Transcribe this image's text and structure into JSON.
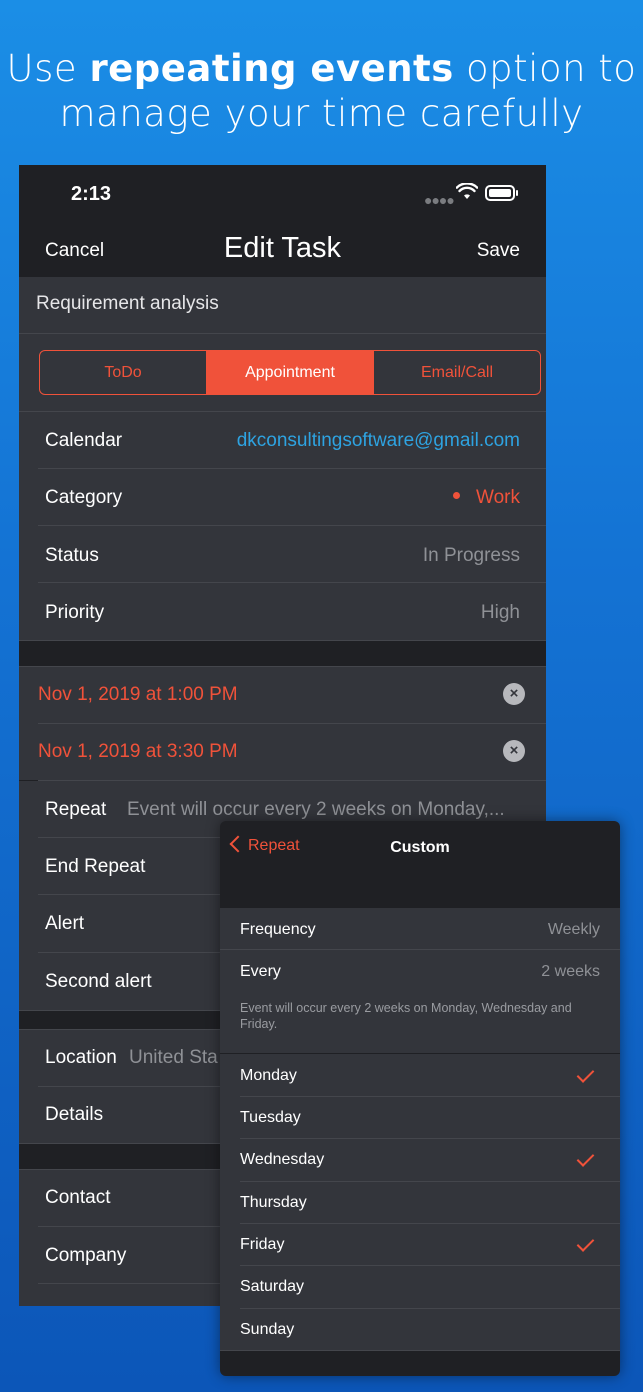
{
  "headline": {
    "prefix": "Use ",
    "bold": "repeating events",
    "suffix": " option to",
    "line2": "manage your time carefully"
  },
  "status_bar": {
    "time": "2:13"
  },
  "nav": {
    "cancel": "Cancel",
    "title": "Edit Task",
    "save": "Save"
  },
  "task": {
    "name": "Requirement analysis"
  },
  "segments": [
    {
      "label": "ToDo",
      "selected": false
    },
    {
      "label": "Appointment",
      "selected": true
    },
    {
      "label": "Email/Call",
      "selected": false
    }
  ],
  "fields": {
    "calendar": {
      "label": "Calendar",
      "value": "dkconsultingsoftware@gmail.com"
    },
    "category": {
      "label": "Category",
      "value": "Work"
    },
    "status": {
      "label": "Status",
      "value": "In Progress"
    },
    "priority": {
      "label": "Priority",
      "value": "High"
    }
  },
  "dates": {
    "start": "Nov 1, 2019 at 1:00 PM",
    "end": "Nov 1, 2019 at 3:30 PM"
  },
  "repeat": {
    "label": "Repeat",
    "value": "Event will occur every 2 weeks on Monday,..."
  },
  "end_repeat": {
    "label": "End Repeat"
  },
  "alert": {
    "label": "Alert"
  },
  "second_alert": {
    "label": "Second alert"
  },
  "location": {
    "label": "Location",
    "value": "United Sta"
  },
  "details": {
    "label": "Details"
  },
  "contact": {
    "label": "Contact"
  },
  "company": {
    "label": "Company"
  },
  "sheet": {
    "back": "Repeat",
    "title": "Custom",
    "frequency": {
      "label": "Frequency",
      "value": "Weekly"
    },
    "every": {
      "label": "Every",
      "value": "2 weeks"
    },
    "note": "Event will occur every 2 weeks on Monday, Wednesday and Friday.",
    "days": [
      {
        "label": "Monday",
        "checked": true
      },
      {
        "label": "Tuesday",
        "checked": false
      },
      {
        "label": "Wednesday",
        "checked": true
      },
      {
        "label": "Thursday",
        "checked": false
      },
      {
        "label": "Friday",
        "checked": true
      },
      {
        "label": "Saturday",
        "checked": false
      },
      {
        "label": "Sunday",
        "checked": false
      }
    ]
  },
  "colors": {
    "accent": "#f0523a",
    "link_blue": "#2ea3e1",
    "background_top": "#1b8ee6",
    "background_bottom": "#0c56b8"
  }
}
